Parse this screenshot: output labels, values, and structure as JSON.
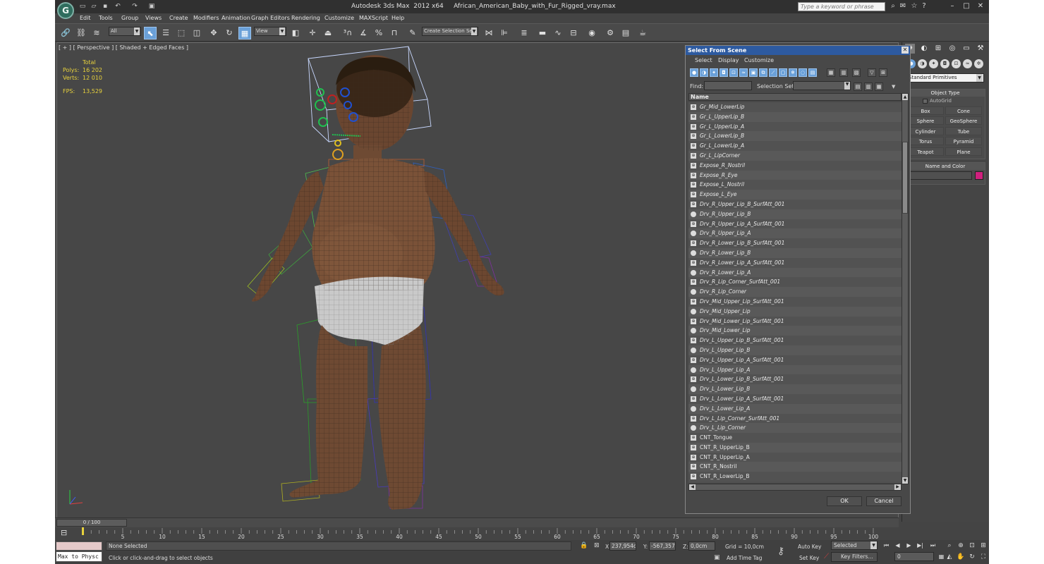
{
  "app": {
    "title": "Autodesk 3ds Max  2012 x64     African_American_Baby_with_Fur_Rigged_vray.max",
    "logo": "3ds-max-logo",
    "search_placeholder": "Type a keyword or phrase"
  },
  "menu": [
    "Edit",
    "Tools",
    "Group",
    "Views",
    "Create",
    "Modifiers",
    "Animation",
    "Graph Editors",
    "Rendering",
    "Customize",
    "MAXScript",
    "Help"
  ],
  "toolbar": {
    "filter_value": "All",
    "refcoord_value": "View",
    "named_selection_value": "Create Selection Se"
  },
  "viewport": {
    "label": "[ + ] [ Perspective ] [ Shaded + Edged Faces ]",
    "stats_header": "Total",
    "polys_label": "Polys:",
    "polys_value": "16 202",
    "verts_label": "Verts:",
    "verts_value": "12 010",
    "fps_label": "FPS:",
    "fps_value": "13,529"
  },
  "command_panel": {
    "category_dropdown": "Standard Primitives",
    "object_type_header": "Object Type",
    "autogrid_label": "AutoGrid",
    "primitives": [
      "Box",
      "Cone",
      "Sphere",
      "GeoSphere",
      "Cylinder",
      "Tube",
      "Torus",
      "Pyramid",
      "Teapot",
      "Plane"
    ],
    "name_color_header": "Name and Color",
    "object_color": "#d0207e"
  },
  "dialog": {
    "title": "Select From Scene",
    "menu": [
      "Select",
      "Display",
      "Customize"
    ],
    "find_label": "Find:",
    "selection_set_label": "Selection Set:",
    "column_name": "Name",
    "ok_label": "OK",
    "cancel_label": "Cancel",
    "items": [
      {
        "name": "Gr_Mid_LowerLip",
        "icon": "helper"
      },
      {
        "name": "Gr_L_UpperLip_B",
        "icon": "helper"
      },
      {
        "name": "Gr_L_UpperLip_A",
        "icon": "helper"
      },
      {
        "name": "Gr_L_LowerLip_B",
        "icon": "helper"
      },
      {
        "name": "Gr_L_LowerLip_A",
        "icon": "helper"
      },
      {
        "name": "Gr_L_LipCorner",
        "icon": "helper"
      },
      {
        "name": "Expose_R_Nostril",
        "icon": "helper"
      },
      {
        "name": "Expose_R_Eye",
        "icon": "helper"
      },
      {
        "name": "Expose_L_Nostril",
        "icon": "helper"
      },
      {
        "name": "Expose_L_Eye",
        "icon": "helper"
      },
      {
        "name": "Drv_R_Upper_Lip_B_SurfAtt_001",
        "icon": "helper"
      },
      {
        "name": "Drv_R_Upper_Lip_B",
        "icon": "sphere"
      },
      {
        "name": "Drv_R_Upper_Lip_A_SurfAtt_001",
        "icon": "helper"
      },
      {
        "name": "Drv_R_Upper_Lip_A",
        "icon": "sphere"
      },
      {
        "name": "Drv_R_Lower_Lip_B_SurfAtt_001",
        "icon": "helper"
      },
      {
        "name": "Drv_R_Lower_Lip_B",
        "icon": "sphere"
      },
      {
        "name": "Drv_R_Lower_Lip_A_SurfAtt_001",
        "icon": "helper"
      },
      {
        "name": "Drv_R_Lower_Lip_A",
        "icon": "sphere"
      },
      {
        "name": "Drv_R_Lip_Corner_SurfAtt_001",
        "icon": "helper"
      },
      {
        "name": "Drv_R_Lip_Corner",
        "icon": "sphere"
      },
      {
        "name": "Drv_Mid_Upper_Lip_SurfAtt_001",
        "icon": "helper"
      },
      {
        "name": "Drv_Mid_Upper_Lip",
        "icon": "sphere"
      },
      {
        "name": "Drv_Mid_Lower_Lip_SurfAtt_001",
        "icon": "helper"
      },
      {
        "name": "Drv_Mid_Lower_Lip",
        "icon": "sphere"
      },
      {
        "name": "Drv_L_Upper_Lip_B_SurfAtt_001",
        "icon": "helper"
      },
      {
        "name": "Drv_L_Upper_Lip_B",
        "icon": "sphere"
      },
      {
        "name": "Drv_L_Upper_Lip_A_SurfAtt_001",
        "icon": "helper"
      },
      {
        "name": "Drv_L_Upper_Lip_A",
        "icon": "sphere"
      },
      {
        "name": "Drv_L_Lower_Lip_B_SurfAtt_001",
        "icon": "helper"
      },
      {
        "name": "Drv_L_Lower_Lip_B",
        "icon": "sphere"
      },
      {
        "name": "Drv_L_Lower_Lip_A_SurfAtt_001",
        "icon": "helper"
      },
      {
        "name": "Drv_L_Lower_Lip_A",
        "icon": "sphere"
      },
      {
        "name": "Drv_L_Lip_Corner_SurfAtt_001",
        "icon": "helper"
      },
      {
        "name": "Drv_L_Lip_Corner",
        "icon": "sphere"
      },
      {
        "name": "CNT_Tongue",
        "icon": "shape"
      },
      {
        "name": "CNT_R_UpperLip_B",
        "icon": "shape"
      },
      {
        "name": "CNT_R_UpperLip_A",
        "icon": "shape"
      },
      {
        "name": "CNT_R_Nostril",
        "icon": "shape"
      },
      {
        "name": "CNT_R_LowerLip_B",
        "icon": "shape"
      }
    ]
  },
  "timeline": {
    "slider_label": "0 / 100",
    "ticks": [
      "5",
      "10",
      "15",
      "20",
      "25",
      "30",
      "35",
      "40",
      "45",
      "50",
      "55",
      "60",
      "65",
      "70",
      "75",
      "80",
      "85",
      "90",
      "95",
      "100"
    ]
  },
  "status": {
    "maxscript_text": "Max to Physc",
    "selection": "None Selected",
    "prompt": "Click or click-and-drag to select objects",
    "x_label": "X:",
    "x_value": "237,954cm",
    "y_label": "Y:",
    "y_value": "-567,357c",
    "z_label": "Z:",
    "z_value": "0,0cm",
    "grid": "Grid = 10,0cm",
    "add_time_tag": "Add Time Tag",
    "auto_key": "Auto Key",
    "set_key": "Set Key",
    "selected_value": "Selected",
    "key_filters": "Key Filters...",
    "frame_value": "0"
  }
}
